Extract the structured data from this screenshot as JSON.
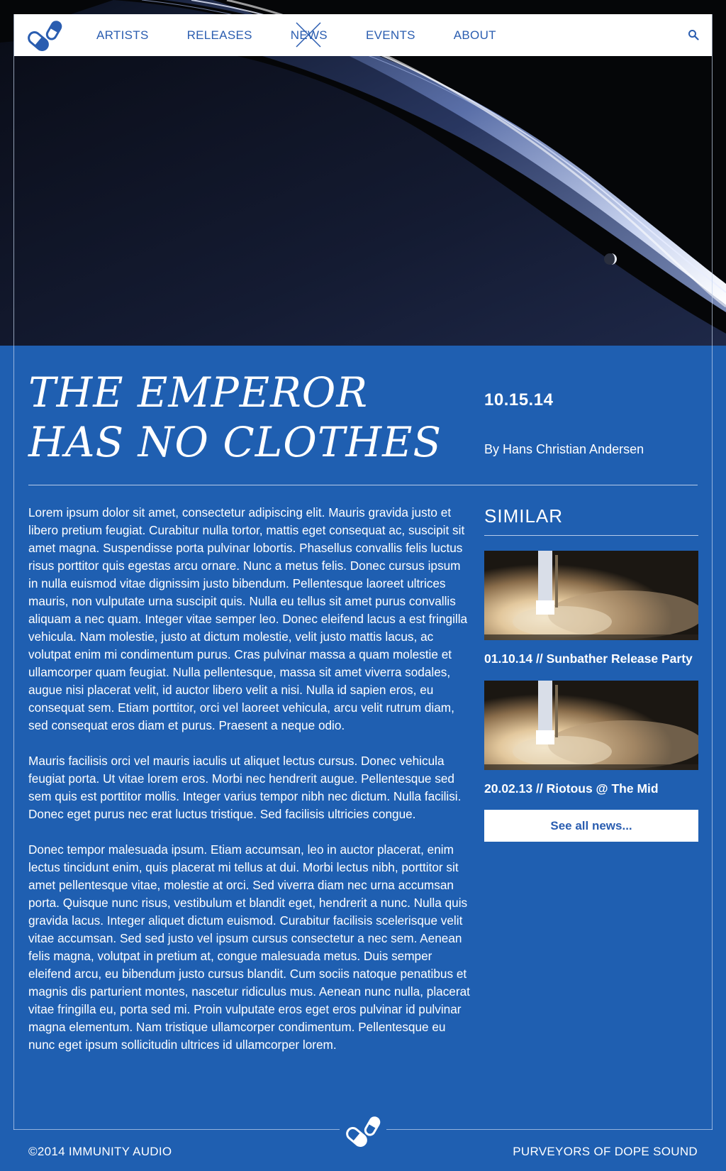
{
  "colors": {
    "brand_blue": "#1f5fb1",
    "nav_text": "#2a5db0",
    "white": "#ffffff"
  },
  "nav": {
    "items": [
      {
        "label": "ARTISTS"
      },
      {
        "label": "RELEASES"
      },
      {
        "label": "NEWS",
        "active": true
      },
      {
        "label": "EVENTS"
      },
      {
        "label": "ABOUT"
      }
    ],
    "search_icon": "search-icon",
    "logo_icon": "pills-logo-icon"
  },
  "article": {
    "title": "THE EMPEROR HAS NO CLOTHES",
    "date": "10.15.14",
    "byline": "By Hans Christian Andersen",
    "paragraphs": [
      "Lorem ipsum dolor sit amet, consectetur adipiscing elit. Mauris gravida justo et libero pretium feugiat. Curabitur nulla tortor, mattis eget consequat ac, suscipit sit amet magna. Suspendisse porta pulvinar lobortis. Phasellus convallis felis luctus risus porttitor quis egestas arcu ornare. Nunc a metus felis. Donec cursus ipsum in nulla euismod vitae dignissim justo bibendum. Pellentesque laoreet ultrices mauris, non vulputate urna suscipit quis. Nulla eu tellus sit amet purus convallis aliquam a nec quam. Integer vitae semper leo. Donec eleifend lacus a est fringilla vehicula. Nam molestie, justo at dictum molestie, velit justo mattis lacus, ac volutpat enim mi condimentum purus. Cras pulvinar massa a quam molestie et ullamcorper quam feugiat. Nulla pellentesque, massa sit amet viverra sodales, augue nisi placerat velit, id auctor libero velit a nisi. Nulla id sapien eros, eu consequat sem. Etiam porttitor, orci vel laoreet vehicula, arcu velit rutrum diam, sed consequat eros diam et purus. Praesent a neque odio.",
      "Mauris facilisis orci vel mauris iaculis ut aliquet lectus cursus. Donec vehicula feugiat porta. Ut vitae lorem eros. Morbi nec hendrerit augue. Pellentesque sed sem quis est porttitor mollis. Integer varius tempor nibh nec dictum. Nulla facilisi. Donec eget purus nec erat luctus tristique. Sed facilisis ultricies congue.",
      "Donec tempor malesuada ipsum. Etiam accumsan, leo in auctor placerat, enim lectus tincidunt enim, quis placerat mi tellus at dui. Morbi lectus nibh, porttitor sit amet pellentesque vitae, molestie at orci. Sed viverra diam nec urna accumsan porta. Quisque nunc risus, vestibulum et blandit eget, hendrerit a nunc. Nulla quis gravida lacus. Integer aliquet dictum euismod. Curabitur facilisis scelerisque velit vitae accumsan. Sed sed justo vel ipsum cursus consectetur a nec sem. Aenean felis magna, volutpat in pretium at, congue malesuada metus. Duis semper eleifend arcu, eu bibendum justo cursus blandit. Cum sociis natoque penatibus et magnis dis parturient montes, nascetur ridiculus mus. Aenean nunc nulla, placerat vitae fringilla eu, porta sed mi. Proin vulputate eros eget eros pulvinar id pulvinar magna elementum. Nam tristique ullamcorper condimentum. Pellentesque eu nunc eget ipsum sollicitudin ultrices id ullamcorper lorem."
    ]
  },
  "sidebar": {
    "title": "SIMILAR",
    "items": [
      {
        "caption": "01.10.14 // Sunbather Release Party"
      },
      {
        "caption": "20.02.13 // Riotous @ The Mid"
      }
    ],
    "see_all_label": "See all news..."
  },
  "footer": {
    "left": "©2014 IMMUNITY AUDIO",
    "right": "PURVEYORS OF DOPE SOUND"
  }
}
